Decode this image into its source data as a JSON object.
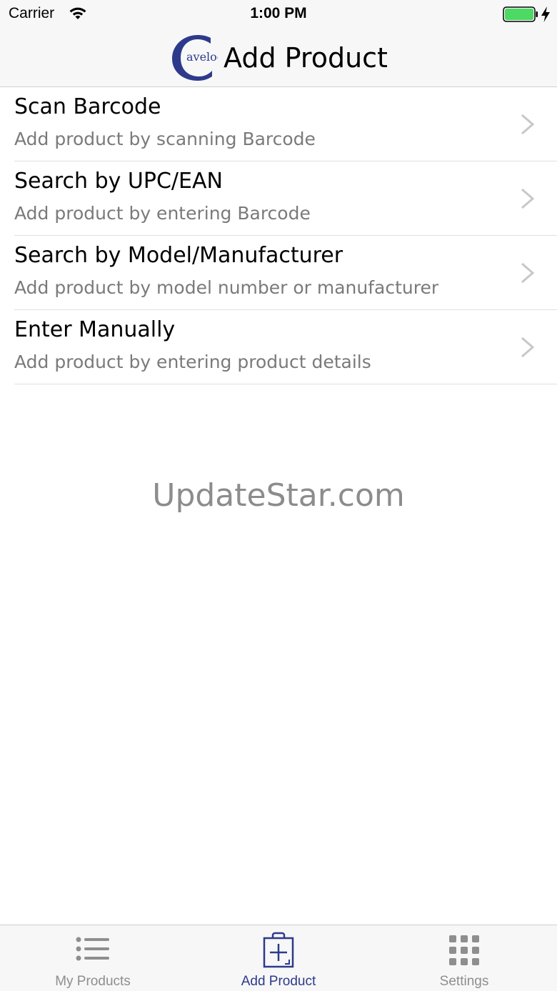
{
  "status_bar": {
    "carrier": "Carrier",
    "time": "1:00 PM"
  },
  "nav": {
    "logo_text": "avelog",
    "title": "Add Product"
  },
  "options": [
    {
      "title": "Scan Barcode",
      "subtitle": "Add product by scanning Barcode"
    },
    {
      "title": "Search by UPC/EAN",
      "subtitle": "Add product by entering Barcode"
    },
    {
      "title": "Search by Model/Manufacturer",
      "subtitle": "Add product by model number or manufacturer"
    },
    {
      "title": "Enter Manually",
      "subtitle": "Add product by entering product details"
    }
  ],
  "watermark": "UpdateStar.com",
  "tabs": [
    {
      "label": "My Products",
      "icon": "list-icon"
    },
    {
      "label": "Add Product",
      "icon": "add-bag-icon",
      "active": true
    },
    {
      "label": "Settings",
      "icon": "grid-icon"
    }
  ],
  "colors": {
    "accent": "#2d3a8c",
    "battery": "#4cd964",
    "chevron": "#c7c7cc"
  }
}
